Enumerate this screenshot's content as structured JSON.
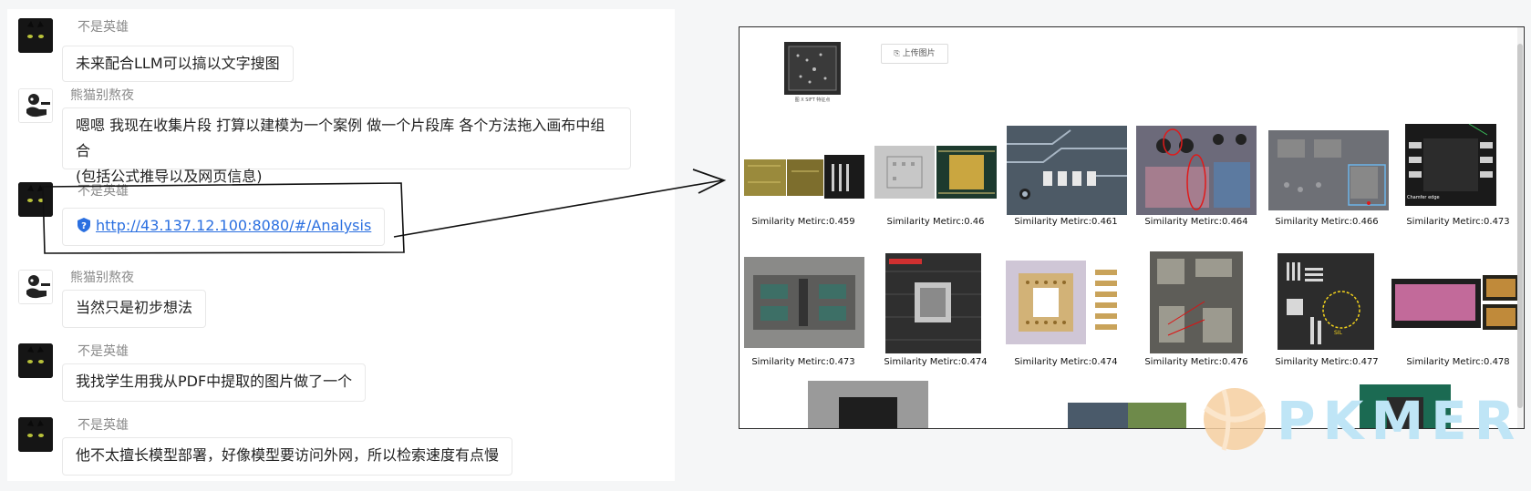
{
  "chat": {
    "messages": [
      {
        "sender": "不是英雄",
        "text": "未来配合LLM可以搞以文字搜图"
      },
      {
        "sender": "熊猫别熬夜",
        "lines": [
          "嗯嗯 我现在收集片段 打算以建模为一个案例 做一个片段库 各个方法拖入画布中组合",
          "(包括公式推导以及网页信息)"
        ]
      },
      {
        "sender": "不是英雄",
        "link": "http://43.137.12.100:8080/#/Analysis"
      },
      {
        "sender": "熊猫别熬夜",
        "text": "当然只是初步想法"
      },
      {
        "sender": "不是英雄",
        "text": "我找学生用我从PDF中提取的图片做了一个"
      },
      {
        "sender": "不是英雄",
        "text": "他不太擅长模型部署，好像模型要访问外网，所以检索速度有点慢"
      }
    ]
  },
  "panel": {
    "upload_label": "上传图片",
    "query_caption": "图 X  SIFT 特征点",
    "results": [
      {
        "caption": "Similarity Metirc:0.459"
      },
      {
        "caption": "Similarity Metirc:0.46"
      },
      {
        "caption": "Similarity Metirc:0.461"
      },
      {
        "caption": "Similarity Metirc:0.464"
      },
      {
        "caption": "Similarity Metirc:0.466"
      },
      {
        "caption": "Similarity Metirc:0.473"
      },
      {
        "caption": "Similarity Metirc:0.473"
      },
      {
        "caption": "Similarity Metirc:0.474"
      },
      {
        "caption": "Similarity Metirc:0.474"
      },
      {
        "caption": "Similarity Metirc:0.476"
      },
      {
        "caption": "Similarity Metirc:0.477"
      },
      {
        "caption": "Similarity Metirc:0.478"
      }
    ],
    "chamfer_label": "Chamfer edge",
    "sil_label": "SIL"
  },
  "watermark": {
    "text": "PKMER"
  },
  "colors": {
    "link": "#2a6fe0",
    "name": "#8a8a8a",
    "watermark_text": "#bfe5f6",
    "watermark_logo": "#f6cfa0"
  },
  "icons": [
    "cat-avatar-icon",
    "panda-avatar-icon",
    "shield-question-icon",
    "upload-icon",
    "arrow-icon",
    "pkmer-logo-icon"
  ]
}
